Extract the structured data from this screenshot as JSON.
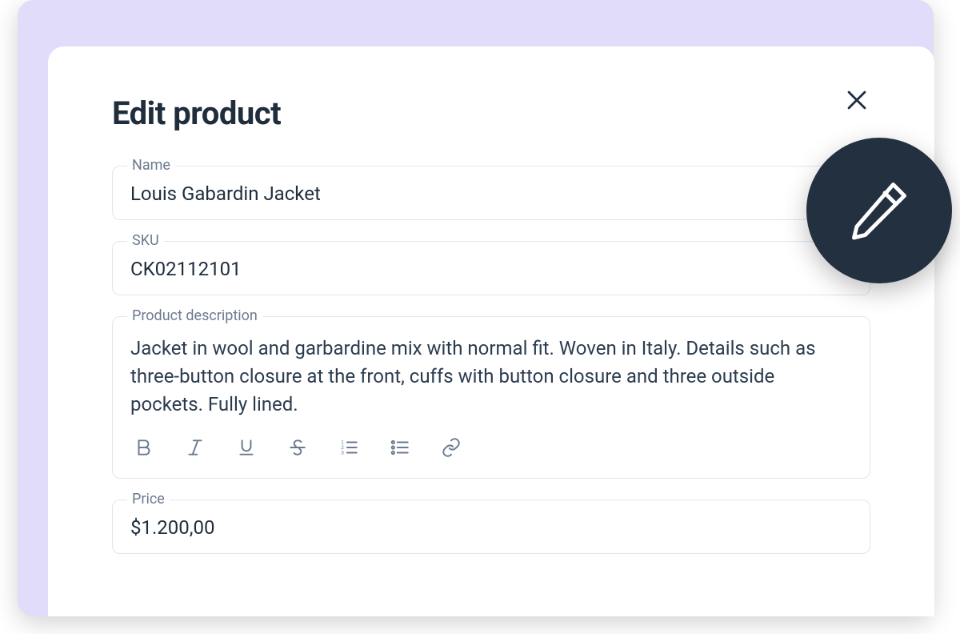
{
  "dialog": {
    "title": "Edit product"
  },
  "fields": {
    "name": {
      "label": "Name",
      "value": "Louis Gabardin Jacket"
    },
    "sku": {
      "label": "SKU",
      "value": "CK02112101"
    },
    "description": {
      "label": "Product description",
      "value": "Jacket in wool and garbardine mix with normal fit. Woven in Italy. Details such as three-button closure at the front, cuffs with button closure and three outside pockets. Fully lined."
    },
    "price": {
      "label": "Price",
      "value": "$1.200,00"
    }
  }
}
